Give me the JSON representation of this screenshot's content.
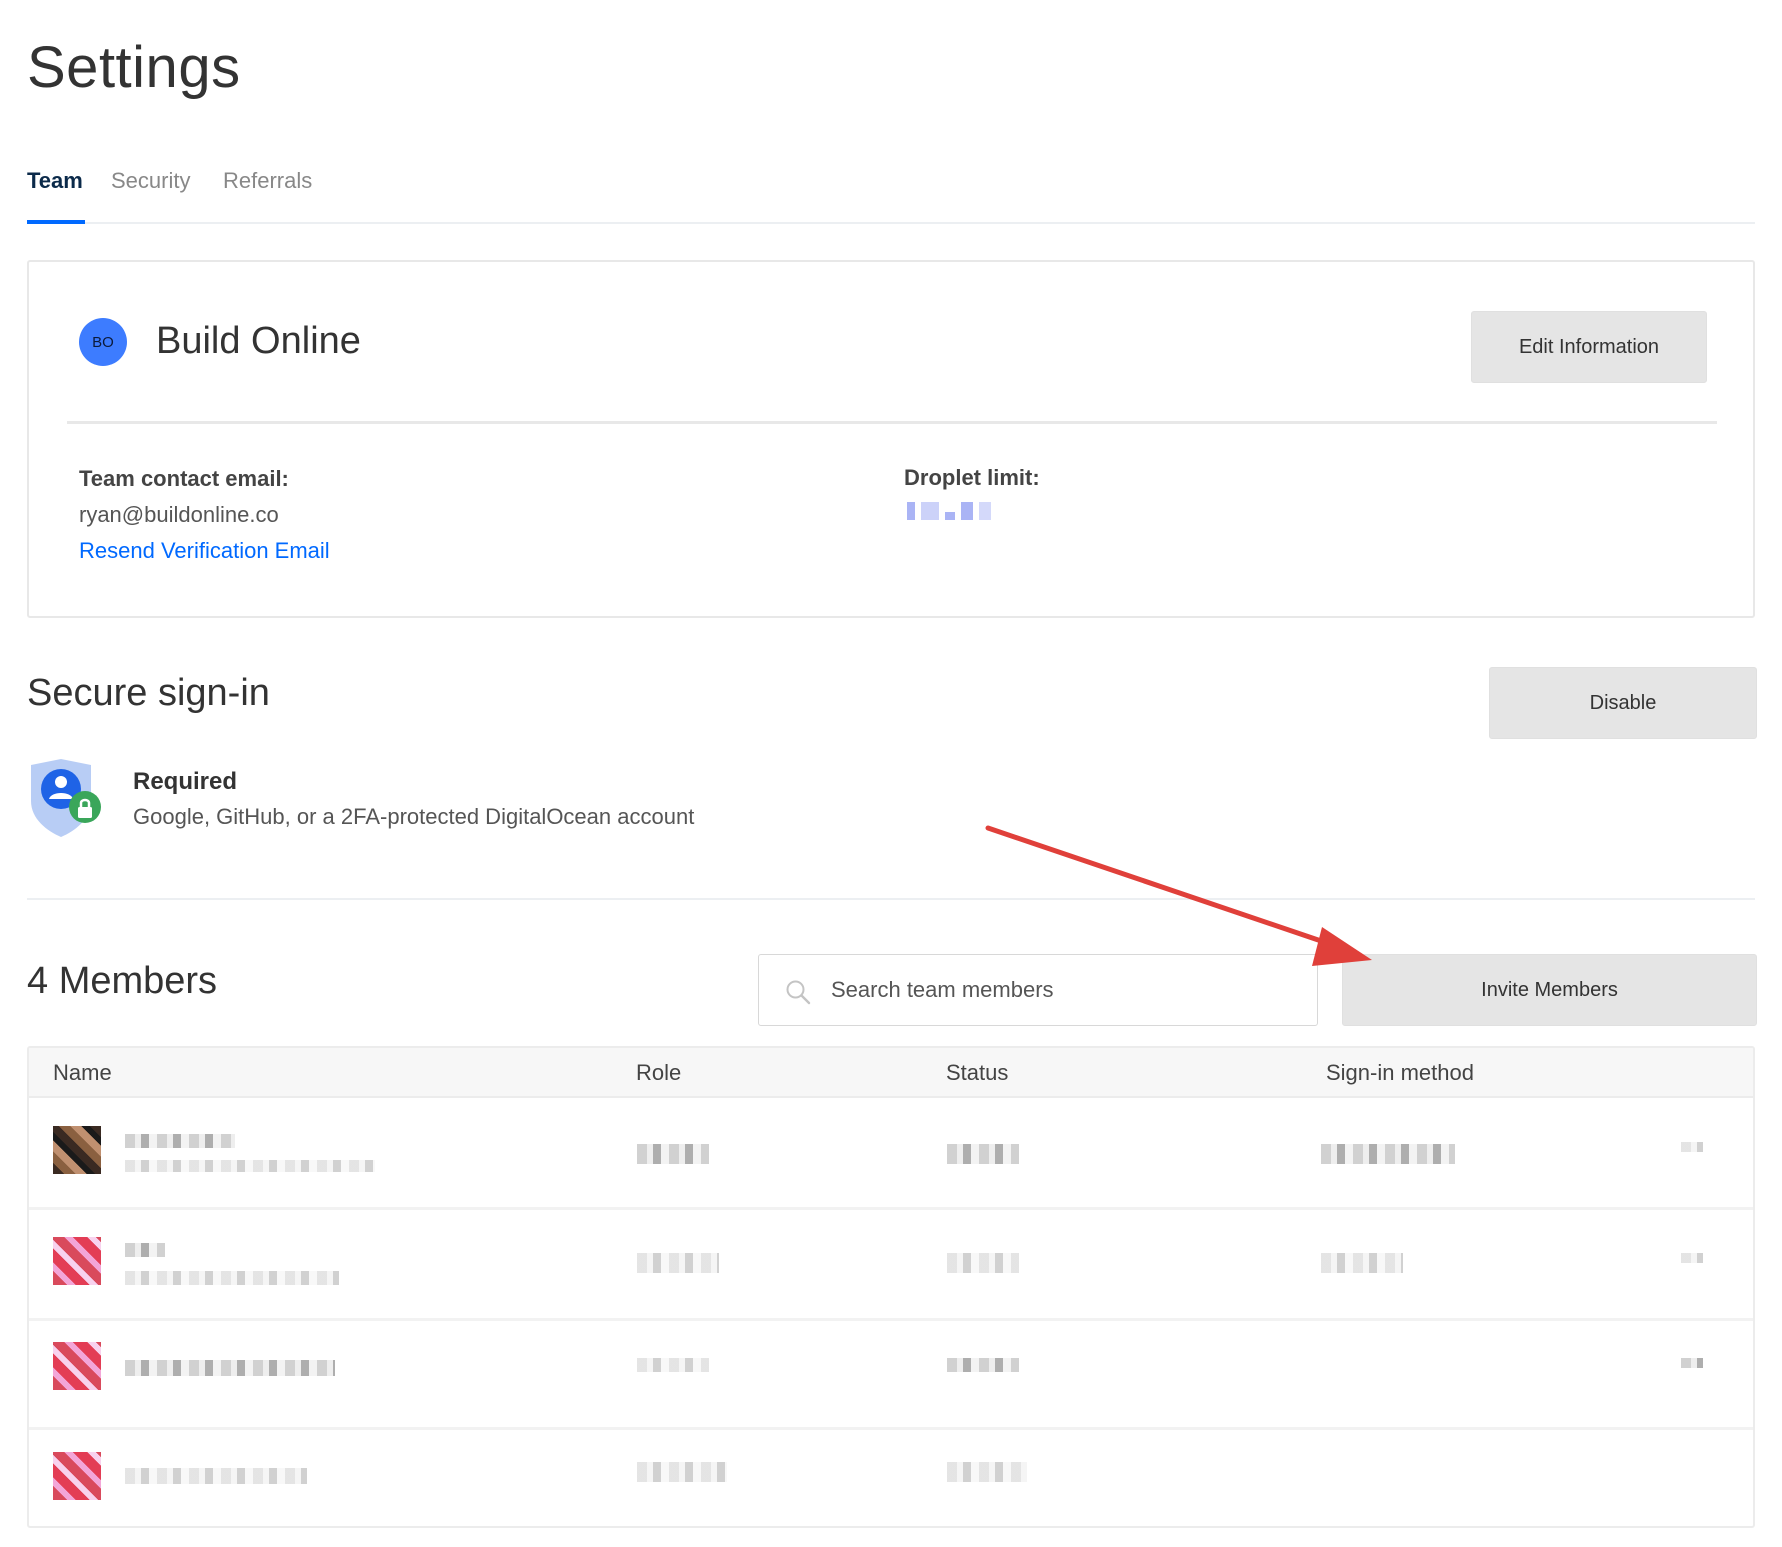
{
  "page": {
    "title": "Settings"
  },
  "tabs": [
    {
      "label": "Team",
      "active": true
    },
    {
      "label": "Security",
      "active": false
    },
    {
      "label": "Referrals",
      "active": false
    }
  ],
  "team": {
    "initials": "BO",
    "name": "Build Online",
    "edit_label": "Edit Information",
    "contact_label": "Team contact email:",
    "contact_email": "ryan@buildonline.co",
    "resend_label": "Resend Verification Email",
    "droplet_label": "Droplet limit:"
  },
  "secure_signin": {
    "title": "Secure sign-in",
    "disable_label": "Disable",
    "status": "Required",
    "description": "Google, GitHub, or a 2FA-protected DigitalOcean account"
  },
  "members": {
    "title": "4 Members",
    "search_placeholder": "Search team members",
    "invite_label": "Invite Members",
    "columns": [
      "Name",
      "Role",
      "Status",
      "Sign-in method"
    ]
  },
  "colors": {
    "accent": "#0069ff",
    "avatar": "#3d7cff",
    "annotation_arrow": "#e0403a"
  }
}
